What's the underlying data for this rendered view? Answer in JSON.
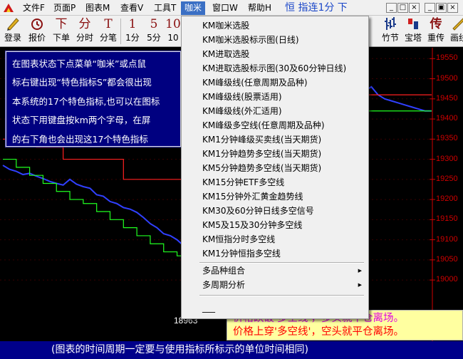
{
  "menubar": {
    "items": [
      "文件F",
      "页面P",
      "图表M",
      "查看V",
      "工具T",
      "咖米",
      "窗口W",
      "帮助H"
    ],
    "active_index": 5,
    "title": "恒 指连1分 下"
  },
  "window_controls": [
    "_",
    "□",
    "×",
    "_",
    "▣",
    "×"
  ],
  "toolbar": {
    "left": [
      {
        "icon": "login-icon",
        "label": "登录"
      },
      {
        "icon": "quote-icon",
        "label": "报价"
      },
      {
        "icon": "order-icon",
        "label": "下单",
        "glyph": "下"
      },
      {
        "icon": "minute-icon",
        "label": "分时",
        "glyph": "分"
      },
      {
        "icon": "tick-icon",
        "label": "分笔",
        "glyph": "T"
      },
      {
        "icon": "period-1-icon",
        "label": "1分",
        "glyph": "1"
      },
      {
        "icon": "period-5-icon",
        "label": "5分",
        "glyph": "5"
      },
      {
        "icon": "period-10-icon",
        "label": "10",
        "glyph": "10"
      }
    ],
    "right": [
      {
        "icon": "bamboo-icon",
        "label": "竹节"
      },
      {
        "icon": "tower-icon",
        "label": "宝塔"
      },
      {
        "icon": "chuan-icon",
        "label": "重传",
        "glyph": "传"
      },
      {
        "icon": "draw-icon",
        "label": "画线"
      }
    ]
  },
  "dropdown": {
    "items": [
      {
        "label": "KM咖米选股"
      },
      {
        "label": "KM咖米选股标示图(日线)"
      },
      {
        "label": "KM进取选股"
      },
      {
        "label": "KM进取选股标示图(30及60分钟日线)"
      },
      {
        "label": "KM峰级线(任意周期及品种)"
      },
      {
        "label": "KM峰级线(股票适用)"
      },
      {
        "label": "KM峰级线(外汇适用)"
      },
      {
        "label": "KM峰级多空线(任意周期及品种)"
      },
      {
        "label": "KM1分钟峰级买卖线(当天期货)"
      },
      {
        "label": "KM1分钟趋势多空线(当天期货)"
      },
      {
        "label": "KM5分钟趋势多空线(当天期货)"
      },
      {
        "label": "KM15分钟ETF多空线"
      },
      {
        "label": "KM15分钟外汇黄金趋势线"
      },
      {
        "label": "KM30及60分钟日线多空信号"
      },
      {
        "label": "KM5及15及30分钟多空线"
      },
      {
        "label": "KM恒指分时多空线"
      },
      {
        "label": "KM1分钟恒指多空线"
      }
    ],
    "submenus": [
      {
        "label": "多品种组合"
      },
      {
        "label": "多周期分析"
      }
    ],
    "last_item": "___"
  },
  "info_box": {
    "lines": [
      "在图表状态下点菜单“咖米”或点鼠",
      "标右键出现“特色指标S”都会很出现",
      "本系统的17个特色指标,也可以在图标",
      "状态下用键盘按km两个字母，在屏",
      "的右下角也会出现这17个特色指标"
    ]
  },
  "price_axis": [
    "19550",
    "19500",
    "19450",
    "19400",
    "19350",
    "19300",
    "19250",
    "19200",
    "19150",
    "19100",
    "19050",
    "19000"
  ],
  "chart_low_label": "18963",
  "notes": [
    "价格跌破'多空线'，多头就平仓离场。",
    "价格上穿'多空线'，空头就平仓离场。"
  ],
  "status_text": "(图表的时间周期一定要与使用指标所标示的单位时间相同)",
  "chart_data": {
    "type": "line",
    "ylim": [
      18940,
      19570
    ],
    "series": [
      {
        "name": "price",
        "values": [
          19285,
          19275,
          19270,
          19262,
          19265,
          19258,
          19252,
          19245,
          19240,
          19236,
          19250,
          19238,
          19232,
          19228,
          19212,
          19208,
          19195,
          19190,
          19180,
          19176,
          19168,
          19155,
          19140,
          19130,
          19115,
          19110,
          19100,
          19085,
          19070,
          19060,
          19045,
          19038,
          19030,
          19020,
          19010,
          19005,
          18995,
          18985,
          18975,
          18970,
          18963,
          18975,
          18985,
          18990,
          19000,
          19010,
          19050,
          19120,
          19200,
          19280,
          19350,
          19400,
          19430,
          19460,
          19470,
          19480,
          19460,
          19450,
          19445,
          19440,
          19435,
          19430,
          19425,
          19420,
          19420
        ]
      },
      {
        "name": "red-line",
        "values": [
          19350,
          19350,
          19350,
          19350,
          19350,
          19330,
          19330,
          19330,
          19330,
          19300,
          19300,
          19300,
          19300,
          19300,
          19300,
          19300,
          19300,
          19300,
          19250,
          19250,
          19250,
          19250,
          19250,
          19250,
          19250,
          19250,
          19250,
          19250,
          19200,
          19200,
          19200,
          19200,
          19200,
          19200,
          19200,
          19200,
          19200,
          19200,
          19200,
          19200,
          19200,
          19200,
          19250,
          19300,
          19350,
          19400,
          19450,
          19500,
          19520,
          19520,
          19460,
          19460,
          19460,
          19460,
          19460,
          19460,
          19460,
          19460,
          19460,
          19460,
          19460,
          19460,
          19460,
          19460,
          19460
        ]
      },
      {
        "name": "green-line",
        "values": [
          19300,
          19300,
          19280,
          19280,
          19260,
          19260,
          19240,
          19240,
          19220,
          19220,
          19200,
          19200,
          19190,
          19190,
          19170,
          19170,
          19150,
          19150,
          19130,
          19130,
          19110,
          19110,
          19090,
          19090,
          19070,
          19070,
          19060,
          19060,
          19040,
          19040,
          19030,
          19030,
          19020,
          19020,
          19010,
          19010,
          19000,
          19000,
          19000,
          19000,
          19000,
          19000,
          19010,
          19020,
          19040,
          19080,
          19150,
          19230,
          19320,
          19380,
          19410,
          19420,
          19420,
          19420,
          19420,
          19420,
          19420,
          19420,
          19420,
          19420,
          19420,
          19420,
          19420,
          19420,
          19420
        ]
      }
    ]
  }
}
